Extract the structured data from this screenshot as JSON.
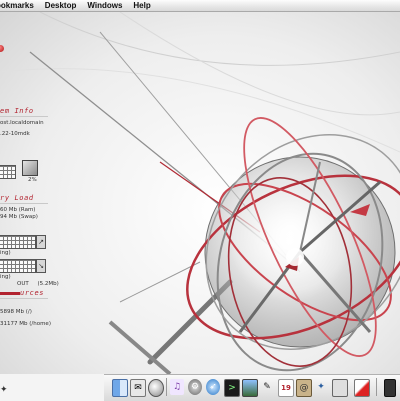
{
  "menubar": {
    "items": [
      "ookmarks",
      "Desktop",
      "Windows",
      "Help"
    ]
  },
  "monitor": {
    "system_title": "em Info",
    "hostname": "ost.localdomain",
    "kernel": ".22-10mdk",
    "cpu_percent": "2%",
    "memory_title": "ry Load",
    "ram": "60 Mb (Ram)",
    "swap": "94 Mb (Swap)",
    "net_in_label": "ing)",
    "net_out_label": "ing)",
    "net_total": "OUT     (5.2Mb)",
    "storage_title": "urces",
    "root_fs": "5898 Mb (/)",
    "home_fs": "31177 Mb (/home)"
  },
  "dock": {
    "icons": [
      "finder-icon",
      "mail-icon",
      "itunes-icon",
      "system-preferences-icon",
      "safari-icon",
      "terminal-icon",
      "photo-icon",
      "pen-icon",
      "calendar-icon",
      "address-book-icon",
      "preferences-icon",
      "monitor-icon",
      "trash-icon"
    ]
  },
  "colors": {
    "accent_red": "#b2232f",
    "menubar_bg": "#e6e6e6"
  }
}
